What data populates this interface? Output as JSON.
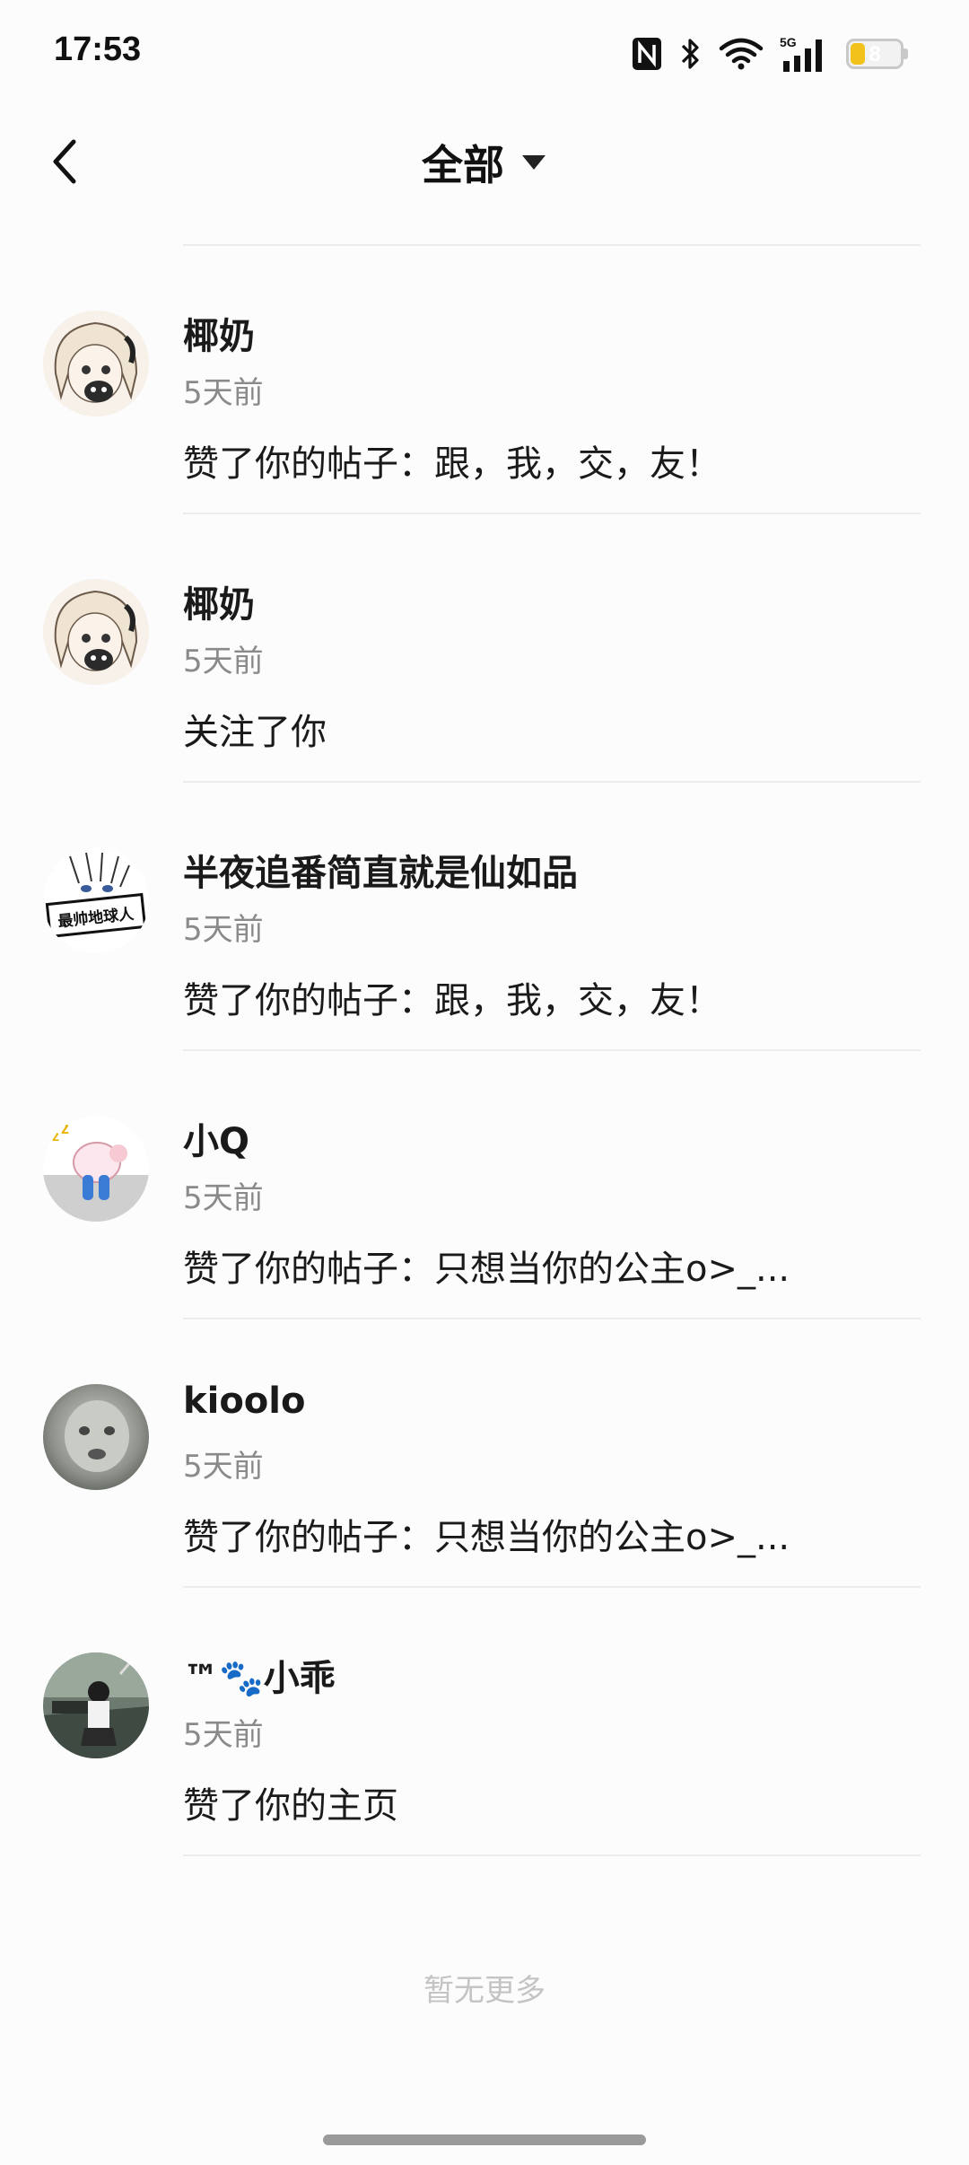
{
  "status_bar": {
    "time": "17:53",
    "network": "5G",
    "battery": "8"
  },
  "nav": {
    "title": "全部",
    "back_icon": "chevron-left-icon",
    "dropdown_icon": "triangle-down-icon"
  },
  "notifications": [
    {
      "name": "椰奶",
      "time": "5天前",
      "message": "赞了你的帖子：跟，我，交，友！"
    },
    {
      "name": "椰奶",
      "time": "5天前",
      "message": "关注了你"
    },
    {
      "name": "半夜追番简直就是仙如品",
      "time": "5天前",
      "message": "赞了你的帖子：跟，我，交，友！"
    },
    {
      "name": "小Q",
      "time": "5天前",
      "message": "赞了你的帖子：只想当你的公主o>_..."
    },
    {
      "name": "kioolo",
      "time": "5天前",
      "message": "赞了你的帖子：只想当你的公主o>_..."
    },
    {
      "name": "™🐾小乖",
      "time": "5天前",
      "message": "赞了你的主页"
    }
  ],
  "footer": {
    "no_more": "暂无更多"
  },
  "avatar_4_text": "最帅地球人"
}
